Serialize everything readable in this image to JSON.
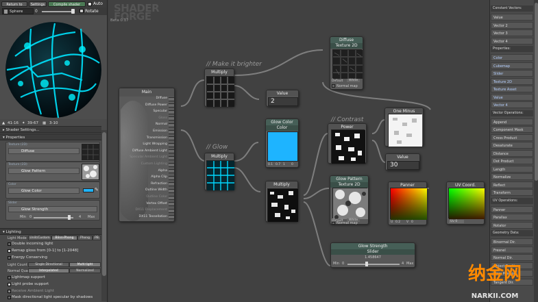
{
  "toolbar": {
    "return_to_menu": "Return to menu",
    "settings": "Settings",
    "compile_shader": "Compile shader",
    "auto": "Auto"
  },
  "preview": {
    "mesh": "Sphere",
    "slider_value": "0",
    "rotate": "Rotate"
  },
  "stats": [
    {
      "label": "41-16",
      "icon": "triangle-icon"
    },
    {
      "label": "39-67",
      "icon": "vertex-icon"
    },
    {
      "label": "3-10",
      "icon": "texture-icon"
    }
  ],
  "left": {
    "shader_settings": "Shader Settings...",
    "properties_header": "Properties",
    "properties": [
      {
        "tag": "Texture (2D)",
        "name": "Diffuse"
      },
      {
        "tag": "Texture (2D)",
        "name": "Glow Pattern"
      },
      {
        "tag": "Color",
        "name": "Glow Color"
      },
      {
        "tag": "Slider",
        "name": "Glow Strength",
        "min_label": "Min",
        "min": "0",
        "max": "4",
        "max_label": "Max"
      }
    ],
    "lighting_header": "Lighting",
    "light_mode_label": "Light Mode",
    "light_modes": [
      "Unlit/Custom",
      "Blinn-Phong",
      "Phong",
      "PB"
    ],
    "lighting_options": [
      {
        "label": "Double incoming light",
        "checked": false
      },
      {
        "label": "Remap gloss from [0-1] to [1-2048]",
        "checked": true
      },
      {
        "label": "Energy Conserving",
        "checked": false
      }
    ],
    "light_count_label": "Light Count",
    "light_counts": [
      "Single Directional",
      "Multi-light"
    ],
    "normal_quality_label": "Normal Quality",
    "normal_qualities": [
      "Interpolated",
      "Normalized"
    ],
    "lighting_options2": [
      {
        "label": "Lightmap support",
        "checked": false
      },
      {
        "label": "Light probe support",
        "checked": true
      },
      {
        "label": "Receive Ambient Light",
        "checked": true
      },
      {
        "label": "Mask directional light specular by shadows",
        "checked": false
      }
    ]
  },
  "canvas": {
    "logo_line1": "SHADER",
    "logo_line2": "FORGE",
    "beta": "Beta 0.17",
    "comments": {
      "brighter": "// Make it brighter",
      "glow": "// Glow",
      "contrast": "// Contrast"
    },
    "main_node": {
      "title": "Main",
      "inputs": [
        "Diffuse",
        "Diffuse Power",
        "Specular",
        "Gloss",
        "Normal",
        "Emission",
        "Transmission",
        "Light Wrapping",
        "Diffuse Ambient Light",
        "Specular Ambient Light",
        "Custom Lighting",
        "Alpha",
        "Alpha Clip",
        "Refraction",
        "Outline Width",
        "Outline Color",
        "Vertex Offset",
        "DX11 Displacement",
        "DX11 Tessellation"
      ],
      "dim_inputs": [
        "Gloss",
        "Specular Ambient Light",
        "Custom Lighting",
        "Outline Color",
        "DX11 Displacement"
      ]
    },
    "diffuse_node": {
      "title": "Diffuse",
      "subtitle": "Texture 2D",
      "default_label": "Default",
      "default_value": "White",
      "normal_map": "Normal map",
      "ports_in": [
        "UV",
        "MIP",
        "Tex"
      ],
      "ports_out": [
        "RGB",
        "R",
        "G",
        "B",
        "A"
      ]
    },
    "multiply_top": {
      "title": "Multiply",
      "ports": [
        "A",
        "B"
      ]
    },
    "value_top": {
      "title": "Value",
      "value": "2"
    },
    "glow_color": {
      "title": "Glow Color",
      "subtitle": "Color",
      "values": [
        "0.1",
        "0.7",
        "1",
        "0"
      ],
      "ports": [
        "RGB",
        "R",
        "G",
        "B",
        "A"
      ],
      "color": "#1eb4ff"
    },
    "multiply_glow": {
      "title": "Multiply",
      "ports": [
        "A",
        "B"
      ]
    },
    "multiply_mid": {
      "title": "Multiply",
      "ports": [
        "A",
        "B",
        "C"
      ]
    },
    "power": {
      "title": "Power",
      "ports": [
        "Val",
        "Exp"
      ]
    },
    "one_minus": {
      "title": "One Minus"
    },
    "value_mid": {
      "title": "Value",
      "value": "30"
    },
    "glow_pattern": {
      "title": "Glow Pattern",
      "subtitle": "Texture 2D",
      "default_label": "Default",
      "default_value": "White",
      "normal_map": "Normal map",
      "ports_in": [
        "UV",
        "MIP",
        "Tex"
      ],
      "ports_out": [
        "RGB",
        "R",
        "G",
        "B",
        "A"
      ]
    },
    "panner": {
      "title": "Panner",
      "ports_in": [
        "UV",
        "Dist"
      ],
      "ports_out": [
        "UV"
      ],
      "u_label": "U",
      "u": "0.2",
      "v_label": "V",
      "v": "0"
    },
    "uv_coord": {
      "title": "UV Coord.",
      "ports": [
        "UV"
      ],
      "uv_label": "Uv 0"
    },
    "glow_strength": {
      "title": "Glow Strength",
      "subtitle": "Slider",
      "value": "1.458647",
      "min_label": "Min",
      "min": "0",
      "max": "4",
      "max_label": "Max"
    }
  },
  "right": {
    "groups": [
      {
        "header": "Constant Vectors:",
        "items": [
          "Value",
          "Vector 2",
          "Vector 3",
          "Vector 4"
        ]
      },
      {
        "header": "Properties:",
        "items": [
          "Color",
          "Cubemap",
          "Slider",
          "Texture 2D",
          "Texture Asset",
          "Value",
          "Vector 4"
        ],
        "blue": true
      },
      {
        "header": "Vector Operations:",
        "items": [
          "Append",
          "Component Mask",
          "Cross Product",
          "Desaturate",
          "Distance",
          "Dot Product",
          "Length",
          "Normalize",
          "Reflect",
          "Transform"
        ]
      },
      {
        "header": "UV Operations:",
        "items": [
          "Panner",
          "Parallax",
          "Rotator"
        ]
      },
      {
        "header": "Geometry Data:",
        "items": [
          "Binormal Dir.",
          "Fresnel",
          "Normal Dir.",
          "Object Position",
          "View Position"
        ]
      }
    ],
    "extra_item": "Tangent Dir."
  },
  "watermark": {
    "chinese": "纳金网",
    "site": "NARKII.COM"
  }
}
